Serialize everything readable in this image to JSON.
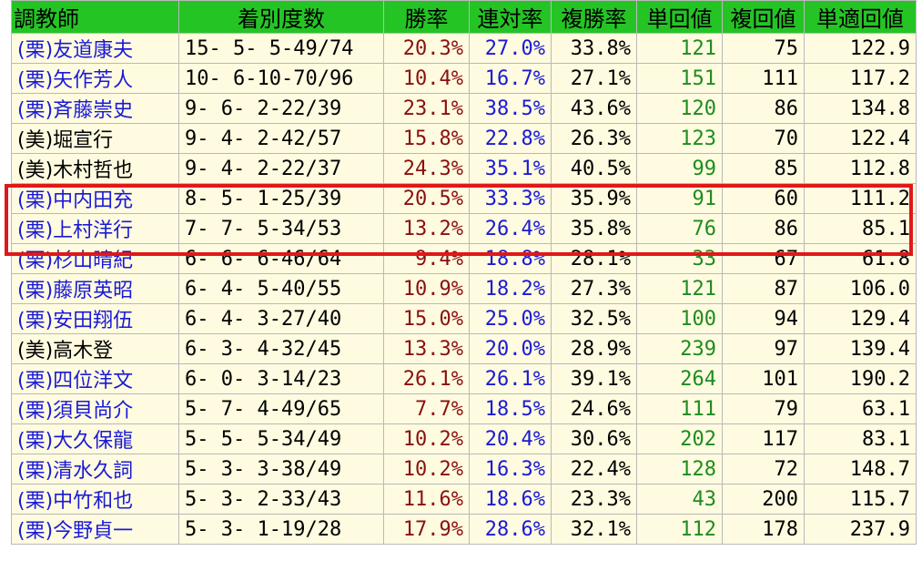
{
  "headers": {
    "trainer": "調教師",
    "record": "着別度数",
    "win_rate": "勝率",
    "quinella_rate": "連対率",
    "place_rate": "複勝率",
    "win_return": "単回値",
    "place_return": "複回値",
    "win_adjusted": "単適回値"
  },
  "colors": {
    "header_bg": "#25c425",
    "row_bg": "#fffbe0",
    "ritto": "#1a1ad6",
    "miho": "#000000",
    "win_rate": "#8a1010",
    "quinella_rate": "#1a1ad6",
    "win_return": "#1e8c1e",
    "highlight": "#e01818"
  },
  "highlighted_rows": [
    "(栗)中内田充",
    "(栗)上村洋行"
  ],
  "rows": [
    {
      "trainer": "(栗)友道康夫",
      "record": "15- 5- 5-49/74",
      "win_rate": "20.3%",
      "quinella_rate": "27.0%",
      "place_rate": "33.8%",
      "win_return": "121",
      "place_return": "75",
      "win_adjusted": "122.9"
    },
    {
      "trainer": "(栗)矢作芳人",
      "record": "10- 6-10-70/96",
      "win_rate": "10.4%",
      "quinella_rate": "16.7%",
      "place_rate": "27.1%",
      "win_return": "151",
      "place_return": "111",
      "win_adjusted": "117.2"
    },
    {
      "trainer": "(栗)斉藤崇史",
      "record": "9- 6- 2-22/39",
      "win_rate": "23.1%",
      "quinella_rate": "38.5%",
      "place_rate": "43.6%",
      "win_return": "120",
      "place_return": "86",
      "win_adjusted": "134.8"
    },
    {
      "trainer": "(美)堀宣行",
      "record": "9- 4- 2-42/57",
      "win_rate": "15.8%",
      "quinella_rate": "22.8%",
      "place_rate": "26.3%",
      "win_return": "123",
      "place_return": "70",
      "win_adjusted": "122.4"
    },
    {
      "trainer": "(美)木村哲也",
      "record": "9- 4- 2-22/37",
      "win_rate": "24.3%",
      "quinella_rate": "35.1%",
      "place_rate": "40.5%",
      "win_return": "99",
      "place_return": "85",
      "win_adjusted": "112.8"
    },
    {
      "trainer": "(栗)中内田充",
      "record": "8- 5- 1-25/39",
      "win_rate": "20.5%",
      "quinella_rate": "33.3%",
      "place_rate": "35.9%",
      "win_return": "91",
      "place_return": "60",
      "win_adjusted": "111.2"
    },
    {
      "trainer": "(栗)上村洋行",
      "record": "7- 7- 5-34/53",
      "win_rate": "13.2%",
      "quinella_rate": "26.4%",
      "place_rate": "35.8%",
      "win_return": "76",
      "place_return": "86",
      "win_adjusted": "85.1"
    },
    {
      "trainer": "(栗)杉山晴紀",
      "record": "6- 6- 6-46/64",
      "win_rate": "9.4%",
      "quinella_rate": "18.8%",
      "place_rate": "28.1%",
      "win_return": "33",
      "place_return": "67",
      "win_adjusted": "61.8"
    },
    {
      "trainer": "(栗)藤原英昭",
      "record": "6- 4- 5-40/55",
      "win_rate": "10.9%",
      "quinella_rate": "18.2%",
      "place_rate": "27.3%",
      "win_return": "121",
      "place_return": "87",
      "win_adjusted": "106.0"
    },
    {
      "trainer": "(栗)安田翔伍",
      "record": "6- 4- 3-27/40",
      "win_rate": "15.0%",
      "quinella_rate": "25.0%",
      "place_rate": "32.5%",
      "win_return": "100",
      "place_return": "94",
      "win_adjusted": "129.4"
    },
    {
      "trainer": "(美)高木登",
      "record": "6- 3- 4-32/45",
      "win_rate": "13.3%",
      "quinella_rate": "20.0%",
      "place_rate": "28.9%",
      "win_return": "239",
      "place_return": "97",
      "win_adjusted": "139.4"
    },
    {
      "trainer": "(栗)四位洋文",
      "record": "6- 0- 3-14/23",
      "win_rate": "26.1%",
      "quinella_rate": "26.1%",
      "place_rate": "39.1%",
      "win_return": "264",
      "place_return": "101",
      "win_adjusted": "190.2"
    },
    {
      "trainer": "(栗)須貝尚介",
      "record": "5- 7- 4-49/65",
      "win_rate": "7.7%",
      "quinella_rate": "18.5%",
      "place_rate": "24.6%",
      "win_return": "111",
      "place_return": "79",
      "win_adjusted": "63.1"
    },
    {
      "trainer": "(栗)大久保龍",
      "record": "5- 5- 5-34/49",
      "win_rate": "10.2%",
      "quinella_rate": "20.4%",
      "place_rate": "30.6%",
      "win_return": "202",
      "place_return": "117",
      "win_adjusted": "83.1"
    },
    {
      "trainer": "(栗)清水久詞",
      "record": "5- 3- 3-38/49",
      "win_rate": "10.2%",
      "quinella_rate": "16.3%",
      "place_rate": "22.4%",
      "win_return": "128",
      "place_return": "72",
      "win_adjusted": "148.7"
    },
    {
      "trainer": "(栗)中竹和也",
      "record": "5- 3- 2-33/43",
      "win_rate": "11.6%",
      "quinella_rate": "18.6%",
      "place_rate": "23.3%",
      "win_return": "43",
      "place_return": "200",
      "win_adjusted": "115.7"
    },
    {
      "trainer": "(栗)今野貞一",
      "record": "5- 3- 1-19/28",
      "win_rate": "17.9%",
      "quinella_rate": "28.6%",
      "place_rate": "32.1%",
      "win_return": "112",
      "place_return": "178",
      "win_adjusted": "237.9"
    }
  ]
}
